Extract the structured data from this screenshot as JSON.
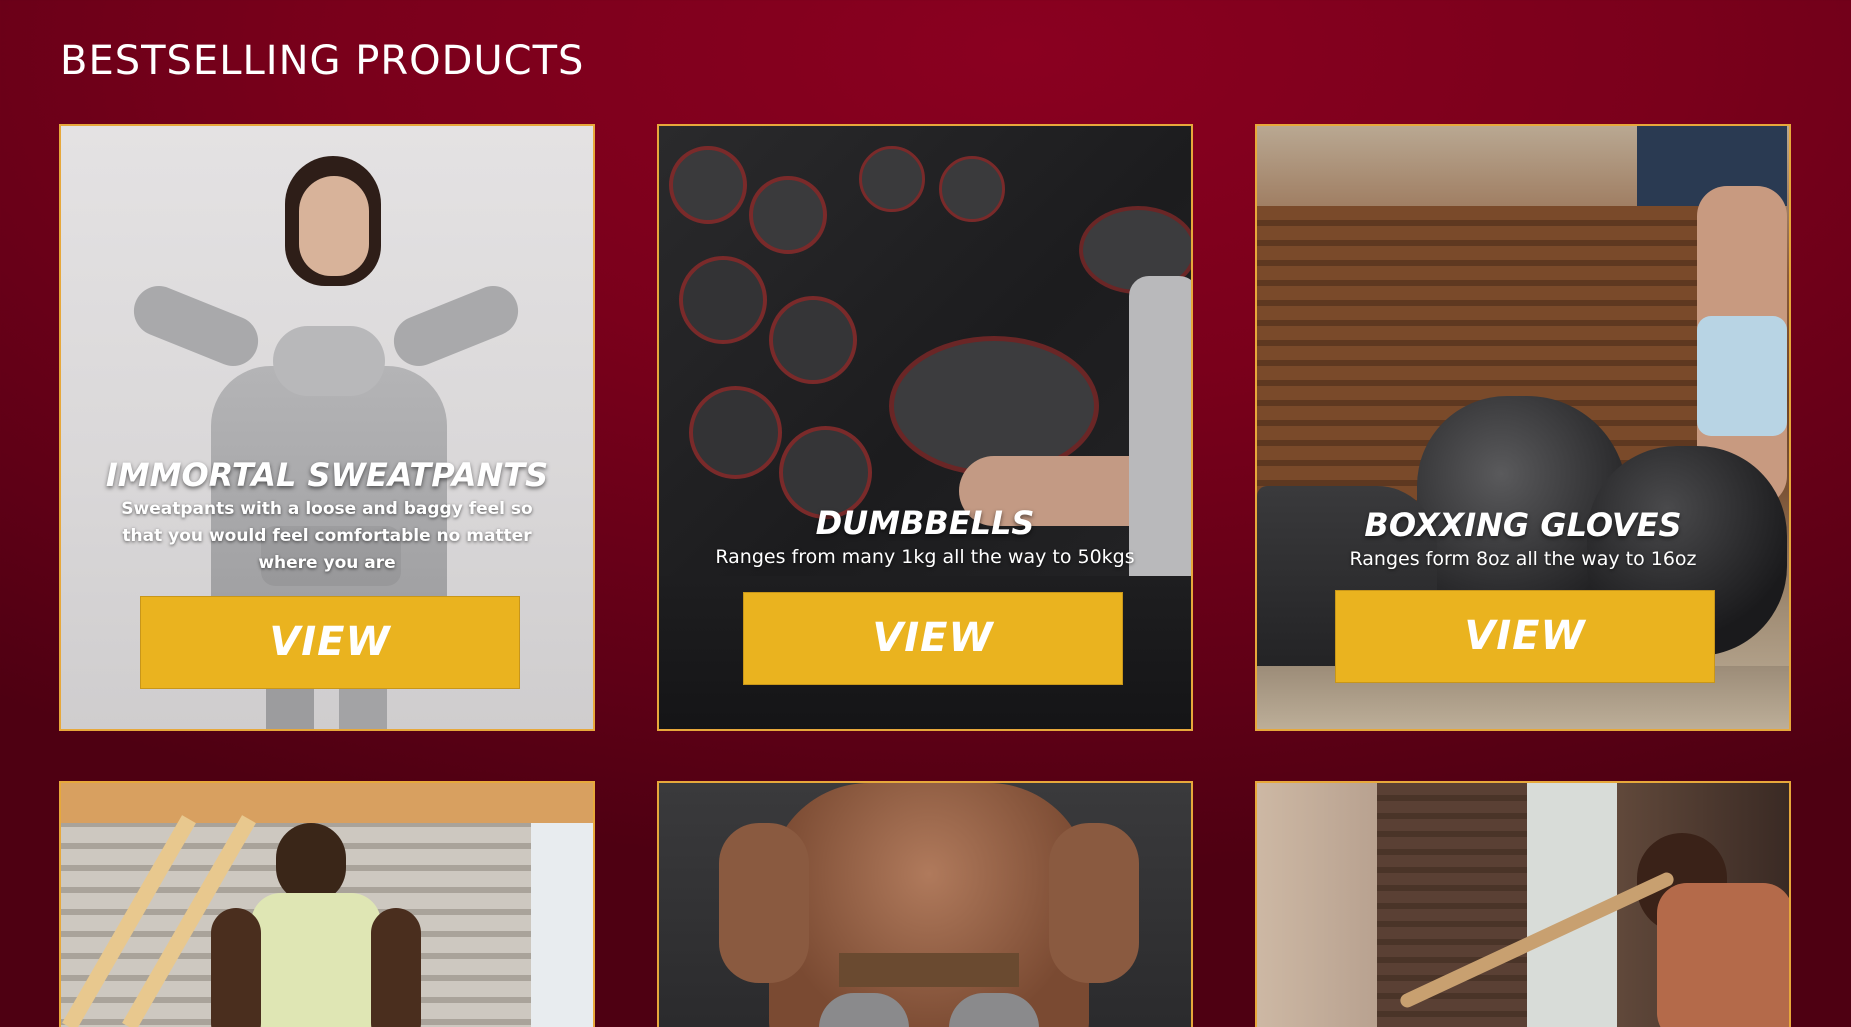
{
  "section": {
    "title": "BESTSELLING PRODUCTS"
  },
  "products": [
    {
      "title": "IMMORTAL SWEATPANTS",
      "description": "Sweatpants with a loose and baggy feel so that you would feel comfortable no matter where you are",
      "button_label": "VIEW"
    },
    {
      "title": "DUMBBELLS",
      "description": "Ranges from many 1kg all the way to 50kgs",
      "button_label": "VIEW"
    },
    {
      "title": "BOXXING GLOVES",
      "description": "Ranges form 8oz all the way to 16oz",
      "button_label": "VIEW"
    }
  ],
  "colors": {
    "background": "#7a001b",
    "card_border": "#e7a83b",
    "button": "#eab31f",
    "text": "#ffffff"
  }
}
